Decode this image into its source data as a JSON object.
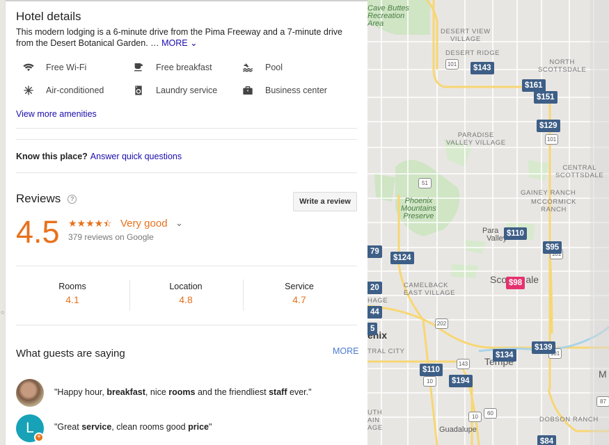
{
  "hotel": {
    "title": "Hotel details",
    "description": "This modern lodging is a 6-minute drive from the Pima Freeway and a 7-minute drive from the Desert Botanical Garden. …",
    "more_label": "MORE",
    "amenities": [
      {
        "icon": "wifi-icon",
        "label": "Free Wi-Fi"
      },
      {
        "icon": "breakfast-icon",
        "label": "Free breakfast"
      },
      {
        "icon": "pool-icon",
        "label": "Pool"
      },
      {
        "icon": "snowflake-icon",
        "label": "Air-conditioned"
      },
      {
        "icon": "laundry-icon",
        "label": "Laundry service"
      },
      {
        "icon": "briefcase-icon",
        "label": "Business center"
      }
    ],
    "view_more": "View more amenities"
  },
  "know": {
    "prompt": "Know this place?",
    "link": "Answer quick questions"
  },
  "reviews": {
    "title": "Reviews",
    "write_button": "Write a review",
    "score": "4.5",
    "stars": 4.5,
    "rating_text": "Very good",
    "count_text": "379 reviews on Google",
    "categories": [
      {
        "label": "Rooms",
        "value": "4.1"
      },
      {
        "label": "Location",
        "value": "4.8"
      },
      {
        "label": "Service",
        "value": "4.7"
      }
    ]
  },
  "guests": {
    "title": "What guests are saying",
    "more": "MORE",
    "quotes": [
      {
        "parts": [
          "\"Happy hour, ",
          "breakfast",
          ", nice ",
          "rooms",
          " and the friendliest ",
          "staff",
          " ever.\""
        ]
      },
      {
        "avatar_letter": "L",
        "parts": [
          "\"Great ",
          "service",
          ", clean rooms good ",
          "price",
          "\""
        ]
      }
    ]
  },
  "map": {
    "labels": [
      "Cave Buttes Recreation Area",
      "DESERT VIEW VILLAGE",
      "DESERT RIDGE",
      "NORTH SCOTTSDALE",
      "PARADISE VALLEY VILLAGE",
      "CENTRAL SCOTTSDALE",
      "GAINEY RANCH",
      "MCCORMICK RANCH",
      "Phoenix Mountains Preserve",
      "Paradise Valley",
      "CAMELBACK EAST VILLAGE",
      "Scottsdale",
      "enix",
      "TRAL CITY",
      "Tempe",
      "DOBSON RANCH",
      "Guadalupe",
      "UTH AIN AGE",
      "HAGE",
      "M"
    ],
    "shields": [
      "101",
      "101",
      "51",
      "202",
      "143",
      "60",
      "10",
      "10",
      "101",
      "87",
      "101"
    ],
    "prices": [
      "$143",
      "$161",
      "$151",
      "$129",
      "$110",
      "$95",
      "$124",
      "$98",
      "$134",
      "$139",
      "$110",
      "$194",
      "$84",
      "79",
      "20",
      "44",
      "5"
    ]
  }
}
